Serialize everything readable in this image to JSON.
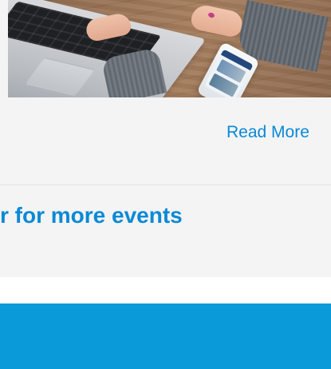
{
  "content": {
    "read_more_label": "Read More",
    "events_heading": "r for more events"
  },
  "hero": {
    "image_description": "Laptop with hands typing and phone on wooden desk"
  },
  "colors": {
    "accent": "#0a89d6",
    "background": "#f4f4f4",
    "divider": "#e3e3e3",
    "band": "#0a9ad9",
    "white": "#ffffff"
  }
}
